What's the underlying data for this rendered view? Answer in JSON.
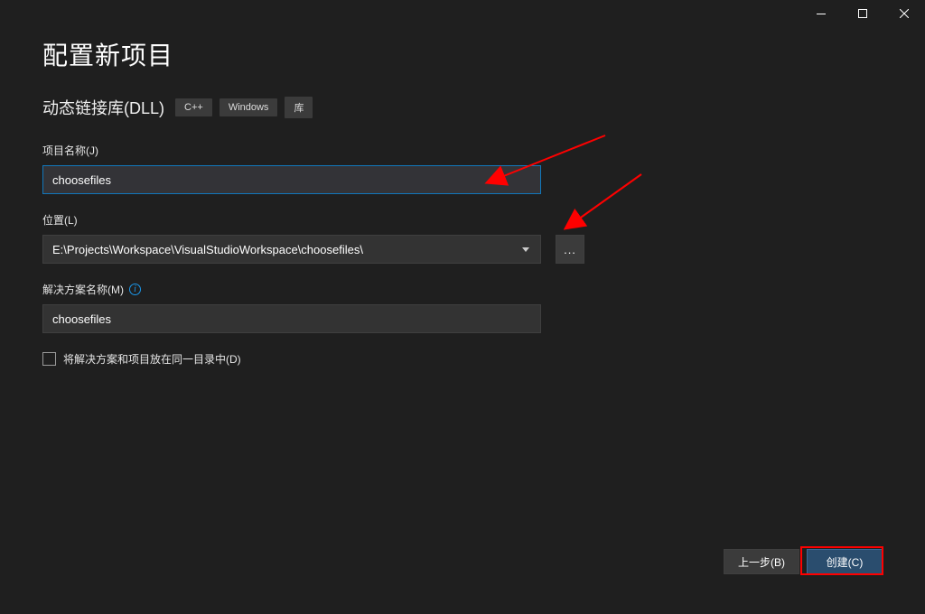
{
  "window": {
    "title": "配置新项目",
    "subtitle": "动态链接库(DLL)",
    "tags": [
      "C++",
      "Windows",
      "库"
    ]
  },
  "fields": {
    "project_name": {
      "label": "项目名称(J)",
      "value": "choosefiles"
    },
    "location": {
      "label": "位置(L)",
      "value": "E:\\Projects\\Workspace\\VisualStudioWorkspace\\choosefiles\\",
      "browse": "..."
    },
    "solution_name": {
      "label": "解决方案名称(M)",
      "value": "choosefiles"
    },
    "same_dir": {
      "label": "将解决方案和项目放在同一目录中(D)",
      "checked": false
    }
  },
  "buttons": {
    "back": "上一步(B)",
    "create": "创建(C)"
  }
}
